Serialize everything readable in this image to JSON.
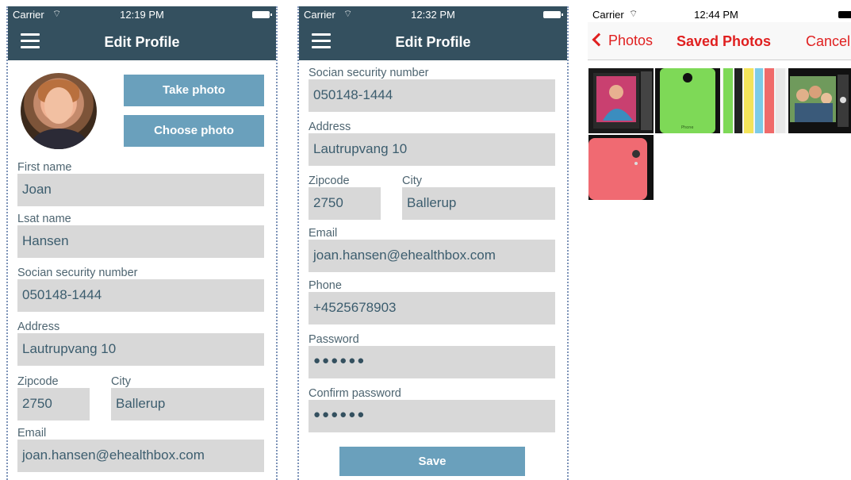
{
  "screen1": {
    "status": {
      "carrier": "Carrier",
      "time": "12:19 PM"
    },
    "nav": {
      "title": "Edit Profile",
      "menu_icon": "hamburger-menu-icon"
    },
    "buttons": {
      "take_photo": "Take photo",
      "choose_photo": "Choose photo"
    },
    "fields": {
      "first_name": {
        "label": "First name",
        "value": "Joan"
      },
      "last_name": {
        "label": "Lsat name",
        "value": "Hansen"
      },
      "ssn": {
        "label": "Socian security number",
        "value": "050148-1444"
      },
      "address": {
        "label": "Address",
        "value": "Lautrupvang 10"
      },
      "zipcode": {
        "label": "Zipcode",
        "value": "2750"
      },
      "city": {
        "label": "City",
        "value": "Ballerup"
      },
      "email": {
        "label": "Email",
        "value": "joan.hansen@ehealthbox.com"
      }
    }
  },
  "screen2": {
    "status": {
      "carrier": "Carrier",
      "time": "12:32 PM"
    },
    "nav": {
      "title": "Edit Profile",
      "menu_icon": "hamburger-menu-icon"
    },
    "fields": {
      "ssn": {
        "label": "Socian security number",
        "value": "050148-1444"
      },
      "address": {
        "label": "Address",
        "value": "Lautrupvang 10"
      },
      "zipcode": {
        "label": "Zipcode",
        "value": "2750"
      },
      "city": {
        "label": "City",
        "value": "Ballerup"
      },
      "email": {
        "label": "Email",
        "value": "joan.hansen@ehealthbox.com"
      },
      "phone": {
        "label": "Phone",
        "value": "+4525678903"
      },
      "password": {
        "label": "Password",
        "value": "●●●●●●"
      },
      "confirm_password": {
        "label": "Confirm password",
        "value": "●●●●●●"
      }
    },
    "save_label": "Save"
  },
  "screen3": {
    "status": {
      "carrier": "Carrier",
      "time": "12:44 PM"
    },
    "nav": {
      "back_label": "Photos",
      "title": "Saved Photos",
      "cancel_label": "Cancel"
    },
    "photos": [
      "ipad-photo",
      "green-phone-photo",
      "colorful-phones-photo",
      "family-photo",
      "pink-phone-photo"
    ]
  },
  "colors": {
    "navbar": "#34505f",
    "button": "#6aa0bc",
    "field_bg": "#d8d8d8",
    "ios_red": "#e02020"
  }
}
